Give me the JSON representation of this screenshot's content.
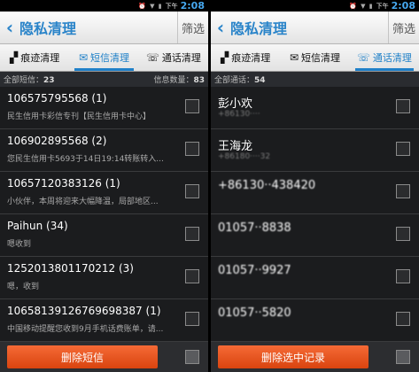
{
  "left": {
    "status": {
      "time": "2:08",
      "ampm": "下午",
      "icons": "⏰ ▼ ▮"
    },
    "header": {
      "back": "‹",
      "title": "隐私清理",
      "filter": "筛选"
    },
    "tabs": [
      {
        "label": "痕迹清理",
        "icon": "broom-icon"
      },
      {
        "label": "短信清理",
        "icon": "envelope-icon"
      },
      {
        "label": "通话清理",
        "icon": "phone-icon"
      }
    ],
    "summary": {
      "left_label": "全部短信：",
      "left_count": "23",
      "right_label": "信息数量：",
      "right_count": "83"
    },
    "rows": [
      {
        "name": "106575795568 (1)",
        "msg": "民生信用卡彩信专刊【民生信用卡中心】"
      },
      {
        "name": "106902895568 (2)",
        "msg": "您民生信用卡5693于14日19:14转账转入..."
      },
      {
        "name": "10657120383126 (1)",
        "msg": "小伙伴，本周将迎来大幅降温，局部地区..."
      },
      {
        "name": "Paihun (34)",
        "msg": "嗯收到"
      },
      {
        "name": "1252013801170212 (3)",
        "msg": "嗯，收到"
      },
      {
        "name": "10658139126769698387 (1)",
        "msg": "中国移动提醒您收到9月手机话费账单，请..."
      }
    ],
    "action": "删除短信"
  },
  "right": {
    "status": {
      "time": "2:08",
      "ampm": "下午",
      "icons": "⏰ ▼ ▮"
    },
    "header": {
      "back": "‹",
      "title": "隐私清理",
      "filter": "筛选"
    },
    "tabs": [
      {
        "label": "痕迹清理",
        "icon": "broom-icon"
      },
      {
        "label": "短信清理",
        "icon": "envelope-icon"
      },
      {
        "label": "通话清理",
        "icon": "phone-icon"
      }
    ],
    "summary": {
      "left_label": "全部通话：",
      "left_count": "54"
    },
    "rows": [
      {
        "name": "彭小欢",
        "msg": "+86130····"
      },
      {
        "name": "王海龙",
        "msg": "+86180····32"
      },
      {
        "name": "+86130··438420",
        "msg": ""
      },
      {
        "name": "01057··8838",
        "msg": ""
      },
      {
        "name": "01057··9927",
        "msg": ""
      },
      {
        "name": "01057··5820",
        "msg": ""
      }
    ],
    "action": "删除选中记录"
  }
}
